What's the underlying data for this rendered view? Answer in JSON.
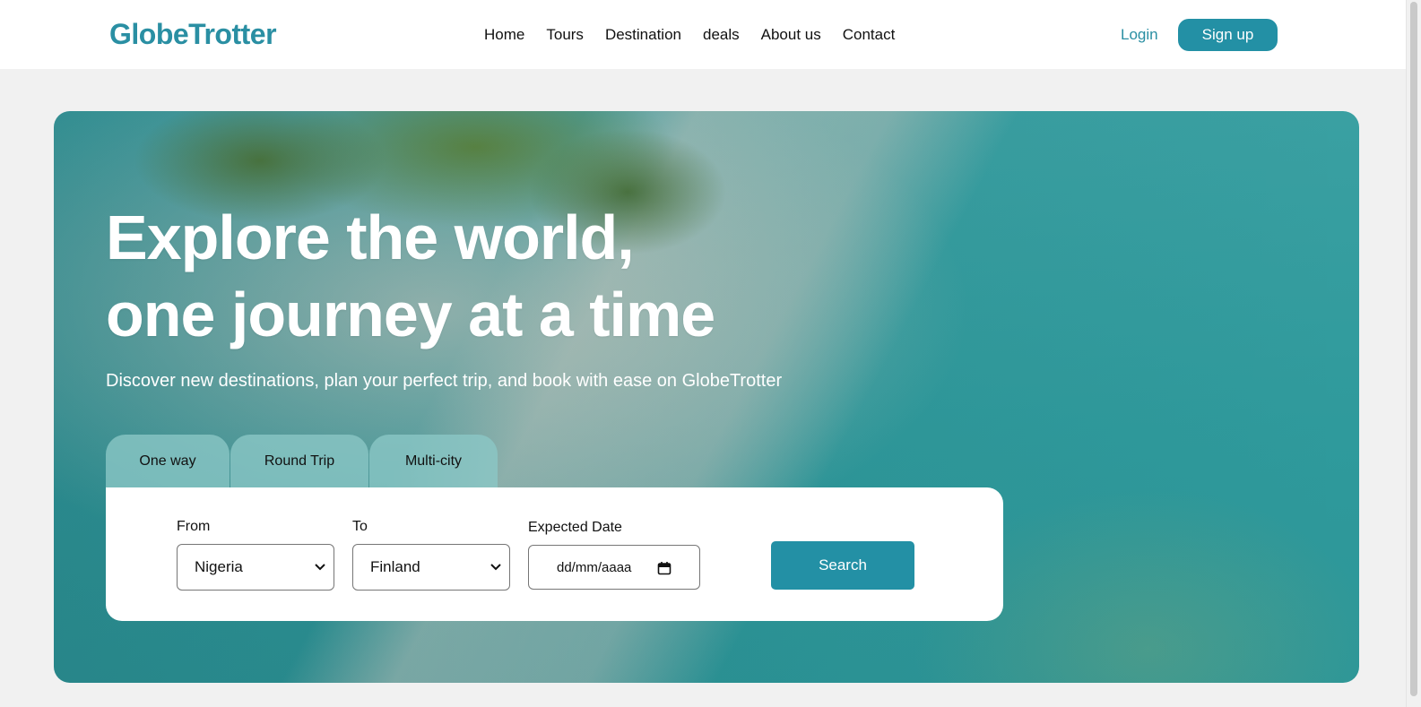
{
  "brand": {
    "name": "GlobeTrotter",
    "color": "#2a8fa3"
  },
  "nav": {
    "links": [
      "Home",
      "Tours",
      "Destination",
      "deals",
      "About us",
      "Contact"
    ],
    "login_label": "Login",
    "signup_label": "Sign up"
  },
  "hero": {
    "title_line1": "Explore the world,",
    "title_line2": "one journey at a time",
    "subtitle": "Discover new destinations, plan your perfect trip, and book with ease on GlobeTrotter"
  },
  "trip_tabs": [
    "One way",
    "Round Trip",
    "Multi-city"
  ],
  "search": {
    "from_label": "From",
    "from_value": "Nigeria",
    "to_label": "To",
    "to_value": "Finland",
    "date_label": "Expected Date",
    "date_placeholder": "dd/mm/aaaa",
    "button_label": "Search"
  },
  "colors": {
    "accent": "#2390a5",
    "page_bg": "#f1f1f1"
  }
}
